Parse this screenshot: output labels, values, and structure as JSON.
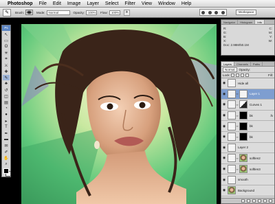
{
  "menubar": {
    "app": "Photoshop",
    "items": [
      "File",
      "Edit",
      "Image",
      "Layer",
      "Select",
      "Filter",
      "View",
      "Window",
      "Help"
    ]
  },
  "options": {
    "brush_label": "Brush:",
    "mode_label": "Mode:",
    "mode_value": "Normal",
    "opacity_label": "Opacity:",
    "opacity_value": "100%",
    "flow_label": "Flow:",
    "flow_value": "100%",
    "workspace_label": "Workspace"
  },
  "toolbox": {
    "header": "Ps",
    "tools": [
      "move",
      "marquee",
      "lasso",
      "magic-wand",
      "crop",
      "slice",
      "healing",
      "brush",
      "stamp",
      "history-brush",
      "eraser",
      "gradient",
      "blur",
      "dodge",
      "path-select",
      "type",
      "pen",
      "shape",
      "notes",
      "eyedropper",
      "hand",
      "zoom"
    ],
    "icons": [
      "↖",
      "▭",
      "ʘ",
      "✳",
      "⌗",
      "⚔",
      "✚",
      "✎",
      "♣",
      "↺",
      "◫",
      "▤",
      "◔",
      "●",
      "▸",
      "T",
      "✒",
      "▬",
      "✉",
      "✐",
      "✋",
      "⌕"
    ],
    "active_index": 7
  },
  "info_panel": {
    "tabs": [
      "Navigator",
      "Histogram",
      "Info"
    ],
    "active_tab": 2,
    "rows": [
      {
        "left": "R:",
        "right": "C:"
      },
      {
        "left": "G:",
        "right": "M:"
      },
      {
        "left": "B:",
        "right": "Y:"
      },
      {
        "left": "X:",
        "right": "W:"
      },
      {
        "left": "Y:",
        "right": "H:"
      }
    ],
    "doc": "Doc: 2.98M/50.1M"
  },
  "layers_panel": {
    "tabs": [
      "Layers",
      "Channels",
      "Paths"
    ],
    "active_tab": 0,
    "blend_mode": "Normal",
    "opacity_label": "Opacity:",
    "lock_label": "Lock:",
    "fill_label": "Fill:",
    "layers": [
      {
        "name": "Hide all",
        "thumb": "white",
        "mask": false,
        "fx": false,
        "selected": false
      },
      {
        "name": "Layer 1",
        "thumb": "white",
        "mask": true,
        "fx": false,
        "selected": true
      },
      {
        "name": "Curves 1",
        "thumb": "adj",
        "mask": true,
        "fx": false,
        "selected": false
      },
      {
        "name": "bk",
        "thumb": "black",
        "mask": true,
        "fx": true,
        "selected": false
      },
      {
        "name": "bk",
        "thumb": "black",
        "mask": true,
        "fx": false,
        "selected": false
      },
      {
        "name": "bk",
        "thumb": "black",
        "mask": true,
        "fx": false,
        "selected": false
      },
      {
        "name": "Layer 2",
        "thumb": "white",
        "mask": false,
        "fx": false,
        "selected": false
      },
      {
        "name": "softlen2",
        "thumb": "portrait",
        "mask": true,
        "fx": false,
        "selected": false
      },
      {
        "name": "softlen3",
        "thumb": "portrait",
        "mask": true,
        "fx": false,
        "selected": false
      },
      {
        "name": "smooth",
        "thumb": "white",
        "mask": false,
        "fx": false,
        "selected": false
      },
      {
        "name": "Background",
        "thumb": "portrait",
        "mask": false,
        "fx": false,
        "selected": false
      }
    ]
  }
}
